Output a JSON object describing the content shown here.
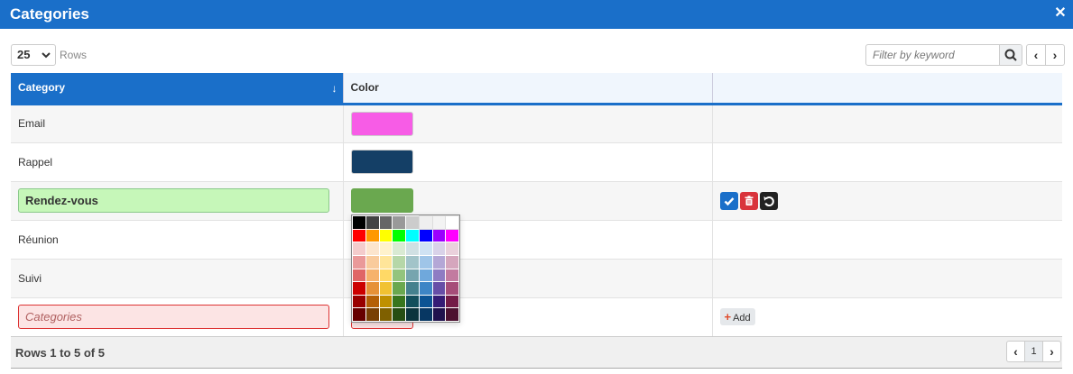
{
  "window": {
    "title": "Categories",
    "close_glyph": "✕"
  },
  "toolbar": {
    "rows_per_page": "25",
    "rows_label": "Rows",
    "filter_placeholder": "Filter by keyword",
    "search_icon": "search-icon",
    "prev_glyph": "‹",
    "next_glyph": "›"
  },
  "table": {
    "columns": [
      {
        "label": "Category",
        "sort_glyph": "↓"
      },
      {
        "label": "Color"
      },
      {
        "label": ""
      }
    ],
    "rows": [
      {
        "category": "Email",
        "color": "#f75ce6"
      },
      {
        "category": "Rappel",
        "color": "#143f66"
      },
      {
        "category": "Rendez-vous",
        "color": "#6aa84f",
        "editing": true
      },
      {
        "category": "Réunion",
        "color": ""
      },
      {
        "category": "Suivi",
        "color": ""
      }
    ],
    "new_row": {
      "placeholder": "Categories",
      "add_label": "Add",
      "add_glyph": "+"
    }
  },
  "palette": {
    "colors": [
      [
        "#000000",
        "#434343",
        "#666666",
        "#999999",
        "#cccccc",
        "#efefef",
        "#f3f3f3",
        "#ffffff"
      ],
      [
        "#ff0000",
        "#ff9900",
        "#ffff00",
        "#00ff00",
        "#00ffff",
        "#0000ff",
        "#9900ff",
        "#ff00ff"
      ],
      [
        "#f4cccc",
        "#fce5cd",
        "#fff2cc",
        "#d9ead3",
        "#d0e0e3",
        "#cfe2f3",
        "#d9d2e9",
        "#ead1dc"
      ],
      [
        "#ea9999",
        "#f9cb9c",
        "#ffe599",
        "#b6d7a8",
        "#a2c4c9",
        "#9fc5e8",
        "#b4a7d6",
        "#d5a6bd"
      ],
      [
        "#e06666",
        "#f6b26b",
        "#ffd966",
        "#93c47d",
        "#76a5af",
        "#6fa8dc",
        "#8e7cc3",
        "#c27ba0"
      ],
      [
        "#cc0000",
        "#e69138",
        "#f1c232",
        "#6aa84f",
        "#45818e",
        "#3d85c6",
        "#674ea7",
        "#a64d79"
      ],
      [
        "#990000",
        "#b45f06",
        "#bf9000",
        "#38761d",
        "#134f5c",
        "#0b5394",
        "#351c75",
        "#741b47"
      ],
      [
        "#660000",
        "#783f04",
        "#7f6000",
        "#274e13",
        "#0c343d",
        "#073763",
        "#20124d",
        "#4c1130"
      ]
    ]
  },
  "footer": {
    "info": "Rows 1 to 5 of 5",
    "page": "1",
    "prev_glyph": "‹",
    "next_glyph": "›"
  }
}
